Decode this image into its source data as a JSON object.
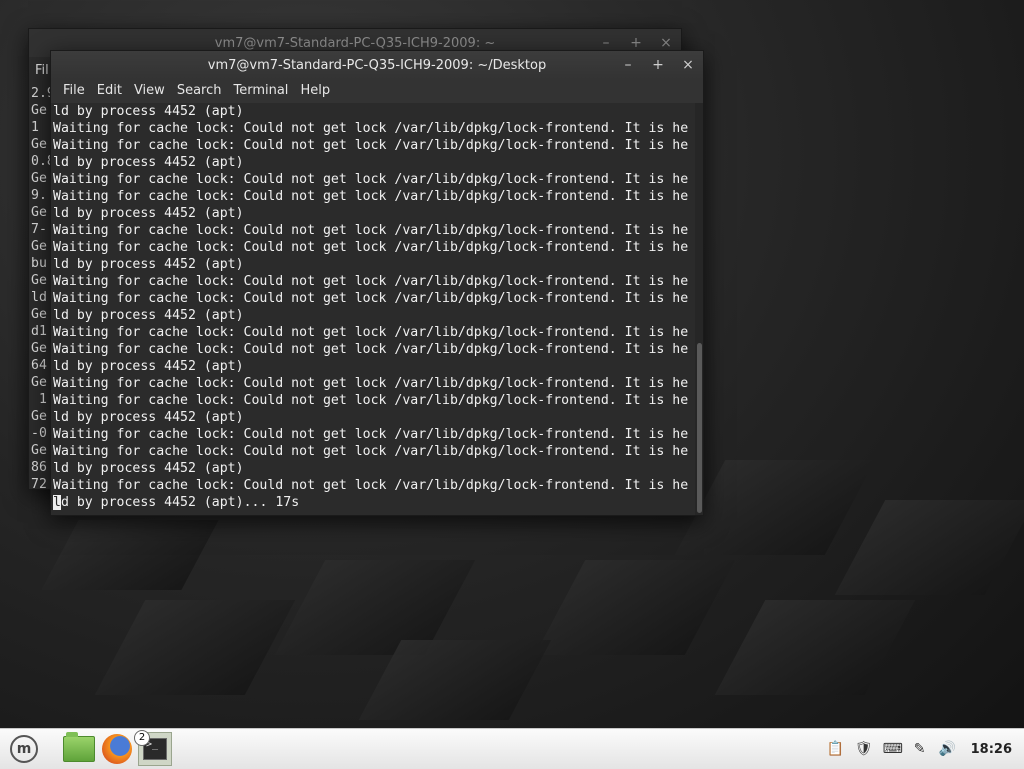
{
  "back_window": {
    "title": "vm7@vm7-Standard-PC-Q35-ICH9-2009: ~",
    "menu_first": "Fil",
    "left_lines": [
      "2.9",
      "Ge",
      "1",
      "Ge",
      "0.8",
      "Ge",
      "9.",
      "Ge",
      "7-",
      "Ge",
      "bu",
      "Ge",
      "ld",
      "Ge",
      "d1",
      "Ge",
      "64",
      "Ge",
      " 1",
      "Ge",
      "-0",
      "Ge",
      "86",
      "72"
    ]
  },
  "front_window": {
    "title": "vm7@vm7-Standard-PC-Q35-ICH9-2009: ~/Desktop",
    "menu": [
      "File",
      "Edit",
      "View",
      "Search",
      "Terminal",
      "Help"
    ],
    "lines": [
      "ld by process 4452 (apt)",
      "Waiting for cache lock: Could not get lock /var/lib/dpkg/lock-frontend. It is he",
      "Waiting for cache lock: Could not get lock /var/lib/dpkg/lock-frontend. It is he",
      "ld by process 4452 (apt)",
      "Waiting for cache lock: Could not get lock /var/lib/dpkg/lock-frontend. It is he",
      "Waiting for cache lock: Could not get lock /var/lib/dpkg/lock-frontend. It is he",
      "ld by process 4452 (apt)",
      "Waiting for cache lock: Could not get lock /var/lib/dpkg/lock-frontend. It is he",
      "Waiting for cache lock: Could not get lock /var/lib/dpkg/lock-frontend. It is he",
      "ld by process 4452 (apt)",
      "Waiting for cache lock: Could not get lock /var/lib/dpkg/lock-frontend. It is he",
      "Waiting for cache lock: Could not get lock /var/lib/dpkg/lock-frontend. It is he",
      "ld by process 4452 (apt)",
      "Waiting for cache lock: Could not get lock /var/lib/dpkg/lock-frontend. It is he",
      "Waiting for cache lock: Could not get lock /var/lib/dpkg/lock-frontend. It is he",
      "ld by process 4452 (apt)",
      "Waiting for cache lock: Could not get lock /var/lib/dpkg/lock-frontend. It is he",
      "Waiting for cache lock: Could not get lock /var/lib/dpkg/lock-frontend. It is he",
      "ld by process 4452 (apt)",
      "Waiting for cache lock: Could not get lock /var/lib/dpkg/lock-frontend. It is he",
      "Waiting for cache lock: Could not get lock /var/lib/dpkg/lock-frontend. It is he",
      "ld by process 4452 (apt)",
      "Waiting for cache lock: Could not get lock /var/lib/dpkg/lock-frontend. It is he"
    ],
    "last_line_cursor_char": "l",
    "last_line_rest": "d by process 4452 (apt)... 17s"
  },
  "window_controls": {
    "minimize": "–",
    "maximize": "+",
    "close": "×"
  },
  "taskbar": {
    "menu_icon": "linux-mint-menu-icon",
    "launchers": [
      "files-folder-icon",
      "firefox-icon"
    ],
    "terminal_badge": "2",
    "tray_icons": [
      "clipboard-icon",
      "shield-update-icon",
      "keyboard-icon",
      "network-icon",
      "volume-icon"
    ],
    "clock": "18:26"
  },
  "colors": {
    "terminal_bg": "#2b2b2b",
    "terminal_fg": "#f0f0f0",
    "titlebar": "#363636",
    "panel": "#ececec"
  }
}
